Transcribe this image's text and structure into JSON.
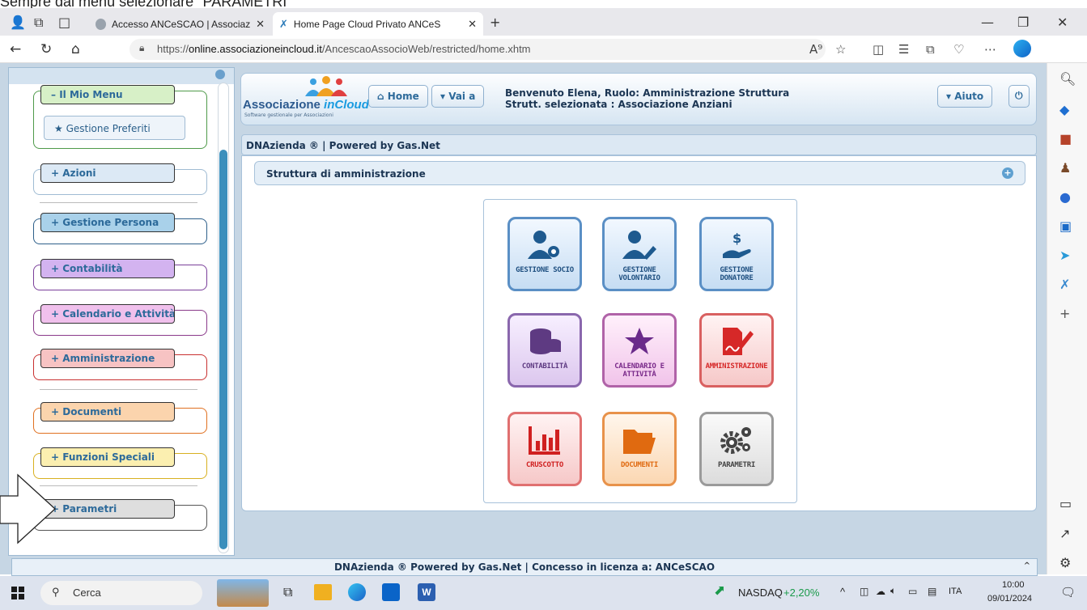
{
  "caption": "Sempre dal menu selezionare \"PARAMETRI\"",
  "browser": {
    "tabs": [
      {
        "title": "Accesso ANCeSCAO | Associazion",
        "active": false
      },
      {
        "title": "Home Page Cloud Privato ANCeS",
        "active": true
      }
    ],
    "new_tab": "+",
    "url_host": "online.associazioneincloud.it",
    "url_path": "/AncescaoAssocioWeb/restricted/home.xhtm",
    "url_prefix": "https://"
  },
  "app": {
    "logo_title_1": "Associazione",
    "logo_title_2": "inCloud",
    "logo_subtitle": "Software gestionale per Associazioni",
    "home_label": "Home",
    "vai_label": "Vai a",
    "aiuto_label": "Aiuto",
    "welcome_line1": "Benvenuto Elena, Ruolo: Amministrazione Struttura",
    "welcome_line2": "Strutt. selezionata : Associazione Anziani",
    "dna_bar": "DNAzienda ® | Powered by Gas.Net",
    "section_title": "Struttura di amministrazione",
    "footer": "DNAzienda ® Powered by Gas.Net | Concesso in licenza a: ANCeSCAO"
  },
  "menu": {
    "mio_menu": "Il Mio Menu",
    "preferiti": "Gestione Preferiti",
    "items": [
      {
        "label": "Azioni"
      },
      {
        "label": "Gestione Persona"
      },
      {
        "label": "Contabilità"
      },
      {
        "label": "Calendario e Attività"
      },
      {
        "label": "Amministrazione"
      },
      {
        "label": "Documenti"
      },
      {
        "label": "Funzioni Speciali"
      },
      {
        "label": "Parametri"
      }
    ]
  },
  "tiles": [
    {
      "label": "GESTIONE SOCIO",
      "color": "#2d6fa8"
    },
    {
      "label": "GESTIONE VOLONTARIO",
      "color": "#2d6fa8"
    },
    {
      "label": "GESTIONE DONATORE",
      "color": "#2d6fa8"
    },
    {
      "label": "CONTABILITÀ",
      "color": "#6a3f8f"
    },
    {
      "label": "CALENDARIO E ATTIVITÀ",
      "color": "#7a2a8a"
    },
    {
      "label": "AMMINISTRAZIONE",
      "color": "#d93030"
    },
    {
      "label": "CRUSCOTTO",
      "color": "#d02020"
    },
    {
      "label": "DOCUMENTI",
      "color": "#e06a10"
    },
    {
      "label": "PARAMETRI",
      "color": "#444444"
    }
  ],
  "taskbar": {
    "search_placeholder": "Cerca",
    "nasdaq_label": "NASDAQ",
    "nasdaq_change": "+2,20%",
    "lang": "ITA",
    "time": "10:00",
    "date": "09/01/2024"
  }
}
